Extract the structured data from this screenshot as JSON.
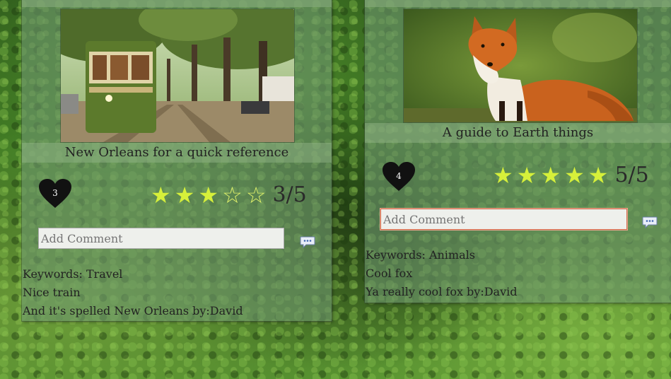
{
  "posts": [
    {
      "caption": "New Orleans for a quick reference",
      "likes": "3",
      "rating": {
        "value": 3,
        "max": 5,
        "label": "3/5"
      },
      "comment_placeholder": "Add Comment",
      "keywords": "Keywords: Travel",
      "description": "Nice train",
      "comment": "And it's spelled New Orleans by:David"
    },
    {
      "caption": "A guide to Earth things",
      "likes": "4",
      "rating": {
        "value": 5,
        "max": 5,
        "label": "5/5"
      },
      "comment_placeholder": "Add Comment",
      "keywords": "Keywords: Animals",
      "description": "Cool fox",
      "comment": "Ya really cool fox by:David"
    }
  ],
  "colors": {
    "star": "#d6f03a",
    "heart": "#111111",
    "card": "#6e966e"
  },
  "icons": {
    "like": "heart-icon",
    "send": "chat-bubble-icon",
    "star": "star-icon"
  }
}
